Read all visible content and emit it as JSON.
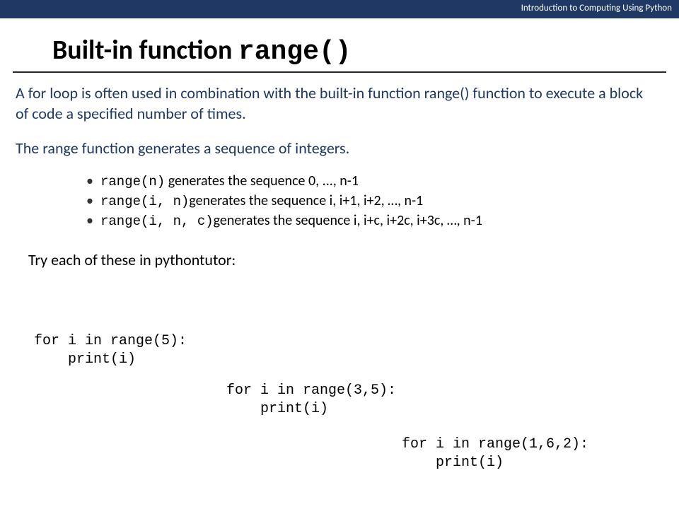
{
  "header": {
    "course": "Introduction to Computing Using Python"
  },
  "title": {
    "prefix": "Built-in function ",
    "mono": "range()"
  },
  "intro": {
    "p1": "A for loop is often used in combination with the built-in function range() function to execute a block of code a specified number of times.",
    "p2": "The range function generates a sequence of integers."
  },
  "bullets": [
    {
      "code": "range(n)",
      "rest": " generates the sequence 0, ..., n-1"
    },
    {
      "code": "range(i, n)",
      "rest": "generates the sequence i, i+1, i+2, …, n-1"
    },
    {
      "code": "range(i, n, c)",
      "rest": "generates the sequence i, i+c, i+2c, i+3c, …, n-1"
    }
  ],
  "tryText": "Try each of these in pythontutor:",
  "codeExamples": {
    "ex1": "for i in range(5):\n    print(i)",
    "ex2": "for i in range(3,5):\n    print(i)",
    "ex3": "for i in range(1,6,2):\n    print(i)"
  }
}
